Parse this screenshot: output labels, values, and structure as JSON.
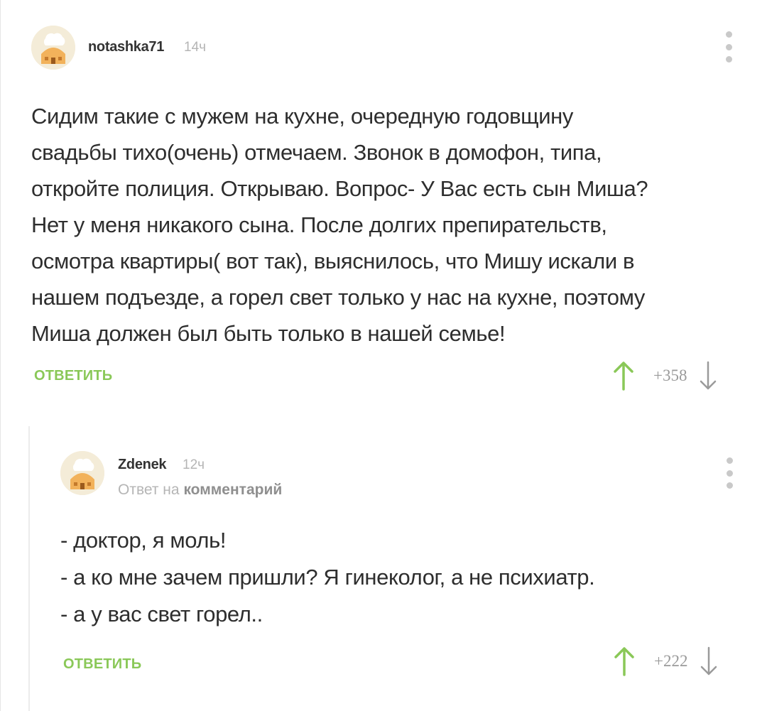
{
  "comments": [
    {
      "username": "notashka71",
      "time": "14ч",
      "lines": [
        "Сидим такие с мужем на кухне, очередную годовщину",
        "свадьбы тихо(очень) отмечаем. Звонок в домофон, типа,",
        "откройте полиция. Открываю. Вопрос- У Вас есть  сын Миша?",
        "Нет у меня никакого сына. После долгих препирательств,",
        "осмотра квартиры( вот так), выяснилось, что Мишу искали в",
        "нашем подъезде, а горел свет только у нас на кухне, поэтому",
        "Миша должен был быть только в нашей семье!"
      ],
      "reply_label": "ОТВЕТИТЬ",
      "score": "+358"
    },
    {
      "username": "Zdenek",
      "time": "12ч",
      "reply_prefix": "Ответ на",
      "reply_link": "комментарий",
      "lines": [
        "- доктор, я моль!",
        "- а ко мне зачем пришли? Я гинеколог, а не психиатр.",
        "- а у вас свет горел.."
      ],
      "reply_label": "ОТВЕТИТЬ",
      "score": "+222"
    }
  ],
  "icons": {
    "avatar": "chef-house-avatar-icon",
    "menu": "kebab-menu-icon",
    "upvote": "arrow-up-icon",
    "downvote": "arrow-down-icon"
  },
  "colors": {
    "accent_green": "#8ac858",
    "muted_gray": "#b5b5b5"
  }
}
